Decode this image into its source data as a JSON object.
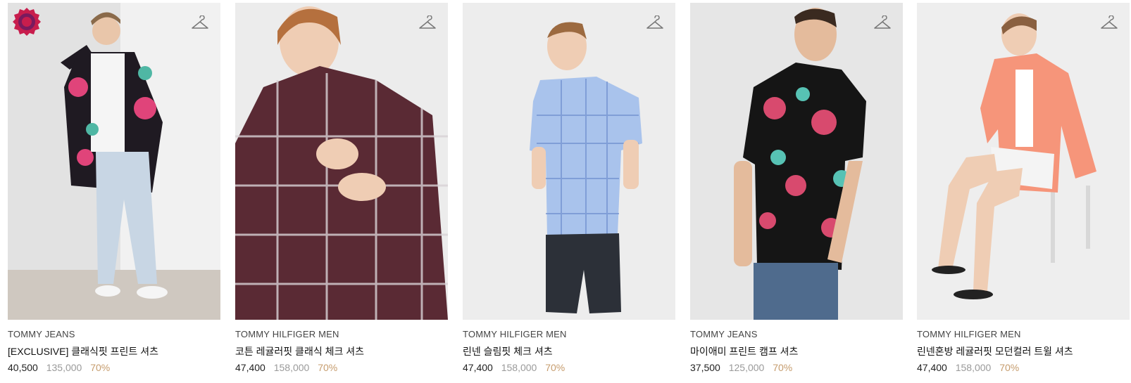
{
  "products": [
    {
      "brand": "TOMMY JEANS",
      "name": "[EXCLUSIVE] 클래식핏 프린트 셔츠",
      "price": "40,500",
      "original_price": "135,000",
      "discount": "70%",
      "badge": "exclusive-badge",
      "colors": {
        "bg": "#e9e9e9",
        "shirt": "#1f1a22",
        "accent": "#e0447a",
        "pants": "#c8d6e4",
        "skin": "#e9c6aa",
        "hair": "#8a6a4a"
      }
    },
    {
      "brand": "TOMMY HILFIGER MEN",
      "name": "코튼 레귤러핏 클래식 체크 셔츠",
      "price": "47,400",
      "original_price": "158,000",
      "discount": "70%",
      "colors": {
        "bg": "#ececec",
        "shirt": "#5a2a34",
        "accent": "#ffffff",
        "pants": "#5a2a34",
        "skin": "#efcdb4",
        "hair": "#b5703e"
      }
    },
    {
      "brand": "TOMMY HILFIGER MEN",
      "name": "린넨 슬림핏 체크 셔츠",
      "price": "47,400",
      "original_price": "158,000",
      "discount": "70%",
      "colors": {
        "bg": "#ededed",
        "shirt": "#a9c3ec",
        "accent": "#6f8fcf",
        "pants": "#2c3038",
        "skin": "#efcdb4",
        "hair": "#9c6a40"
      }
    },
    {
      "brand": "TOMMY JEANS",
      "name": "마이애미 프린트 캠프 셔츠",
      "price": "37,500",
      "original_price": "125,000",
      "discount": "70%",
      "colors": {
        "bg": "#e6e6e6",
        "shirt": "#151515",
        "accent": "#d84a6e",
        "pants": "#4f6b8d",
        "skin": "#e4bb9c",
        "hair": "#3a2a20"
      }
    },
    {
      "brand": "TOMMY HILFIGER MEN",
      "name": "린넨혼방 레귤러핏 모던컬러 트윌 셔츠",
      "price": "47,400",
      "original_price": "158,000",
      "discount": "70%",
      "colors": {
        "bg": "#eeeeee",
        "shirt": "#f6957a",
        "accent": "#ffffff",
        "pants": "#f4f4f4",
        "skin": "#efcdb4",
        "hair": "#8a6040"
      }
    }
  ]
}
